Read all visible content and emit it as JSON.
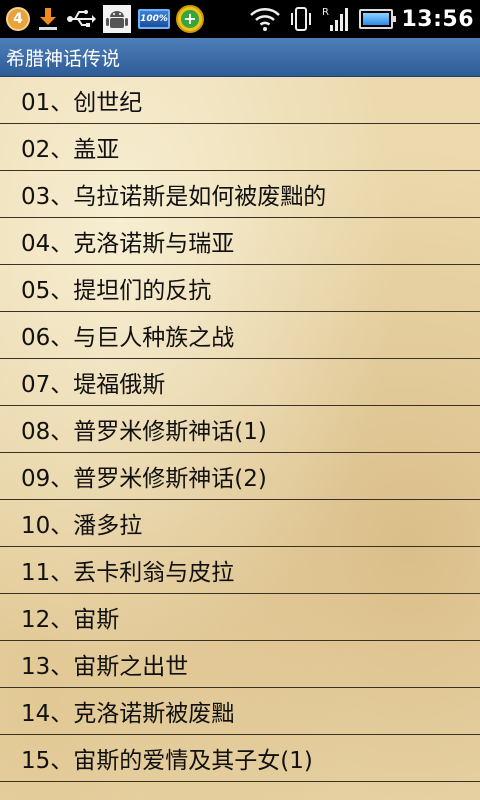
{
  "status_bar": {
    "notification_count": "4",
    "battery_percent_label": "100%",
    "signal_type": "R",
    "time": "13:56",
    "icons": [
      "notification-badge-icon",
      "download-icon",
      "usb-icon",
      "android-debug-icon",
      "battery-percent-icon",
      "plus-app-icon",
      "wifi-icon",
      "vibrate-icon",
      "signal-icon",
      "battery-icon"
    ]
  },
  "title_bar": {
    "title": "希腊神话传说"
  },
  "list": {
    "items": [
      {
        "label": "01、创世纪"
      },
      {
        "label": "02、盖亚"
      },
      {
        "label": "03、乌拉诺斯是如何被废黜的"
      },
      {
        "label": "04、克洛诺斯与瑞亚"
      },
      {
        "label": "05、提坦们的反抗"
      },
      {
        "label": "06、与巨人种族之战"
      },
      {
        "label": "07、堤福俄斯"
      },
      {
        "label": "08、普罗米修斯神话(1)"
      },
      {
        "label": "09、普罗米修斯神话(2)"
      },
      {
        "label": "10、潘多拉"
      },
      {
        "label": "11、丢卡利翁与皮拉"
      },
      {
        "label": "12、宙斯"
      },
      {
        "label": "13、宙斯之出世"
      },
      {
        "label": "14、克洛诺斯被废黜"
      },
      {
        "label": "15、宙斯的爱情及其子女(1)"
      }
    ]
  },
  "colors": {
    "status_bar_bg": "#000000",
    "title_bar_bg": "#3d6ea8",
    "list_bg": "#ecd9ad",
    "divider": "#3a3325",
    "text": "#111111"
  }
}
